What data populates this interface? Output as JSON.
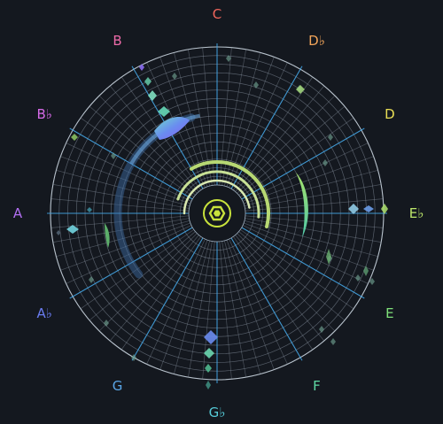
{
  "notes": [
    {
      "label": "C",
      "color": "#f2665c"
    },
    {
      "label": "D♭",
      "color": "#f2a55a"
    },
    {
      "label": "D",
      "color": "#eadf55"
    },
    {
      "label": "E♭",
      "color": "#bce66a"
    },
    {
      "label": "E",
      "color": "#7fe07a"
    },
    {
      "label": "F",
      "color": "#5fd9a4"
    },
    {
      "label": "G♭",
      "color": "#55c9d6"
    },
    {
      "label": "G",
      "color": "#5aa6e8"
    },
    {
      "label": "A♭",
      "color": "#6a7cf0"
    },
    {
      "label": "A",
      "color": "#b26ff2"
    },
    {
      "label": "B♭",
      "color": "#d66ae8"
    },
    {
      "label": "B",
      "color": "#ec6aa8"
    }
  ],
  "colors": {
    "background": "#14181f",
    "grid": "#8d98a6",
    "axis": "#3fa6e8",
    "center": "#c8e23c"
  },
  "center_icon": "hexagon-icon"
}
